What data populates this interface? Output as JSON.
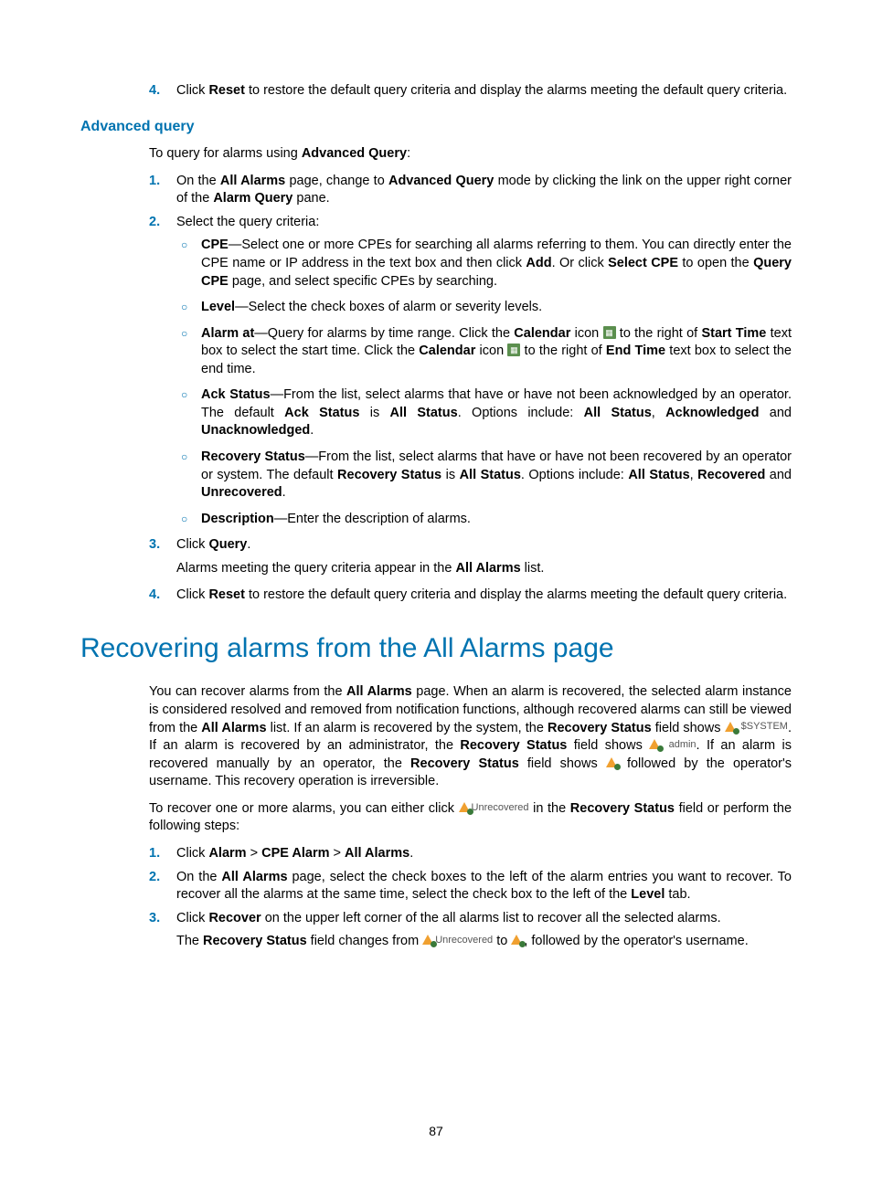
{
  "top": {
    "item4_num": "4.",
    "item4_a": "Click ",
    "item4_b": "Reset",
    "item4_c": " to restore the default query criteria and display the alarms meeting the default query criteria."
  },
  "advq": {
    "heading": "Advanced query",
    "intro_a": "To query for alarms using ",
    "intro_b": "Advanced Query",
    "intro_c": ":",
    "s1": {
      "num": "1.",
      "a": "On the ",
      "b": "All Alarms",
      "c": " page, change to ",
      "d": "Advanced Query",
      "e": " mode by clicking the link on the upper right corner of the ",
      "f": "Alarm Query",
      "g": " pane."
    },
    "s2": {
      "num": "2.",
      "a": "Select the query criteria:"
    },
    "cpe": {
      "b1": "CPE",
      "a": "—Select one or more CPEs for searching all alarms referring to them. You can directly enter the CPE name or IP address in the text box and then click ",
      "b2": "Add",
      "c": ". Or click ",
      "b3": "Select CPE",
      "d": " to open the ",
      "b4": "Query CPE",
      "e": " page, and select specific CPEs by searching."
    },
    "level": {
      "b1": "Level",
      "a": "—Select the check boxes of alarm or severity levels."
    },
    "alarmat": {
      "b1": "Alarm at",
      "a": "—Query for alarms by time range. Click the ",
      "b2": "Calendar",
      "c": " icon ",
      "d": " to the right of ",
      "b3": "Start Time",
      "e": " text box to select the start time. Click the ",
      "b4": "Calendar",
      "f": " icon ",
      "g": " to the right of ",
      "b5": "End Time",
      "h": " text box to select the end time."
    },
    "ack": {
      "b1": "Ack Status",
      "a": "—From the list, select alarms that have or have not been acknowledged by an operator. The default ",
      "b2": "Ack Status",
      "c": " is ",
      "b3": "All Status",
      "d": ". Options include: ",
      "b4": "All Status",
      "e": ", ",
      "b5": "Acknowledged",
      "f": " and ",
      "b6": "Unacknowledged",
      "g": "."
    },
    "rec": {
      "b1": "Recovery Status",
      "a": "—From the list, select alarms that have or have not been recovered by an operator or system. The default ",
      "b2": "Recovery Status",
      "c": " is ",
      "b3": "All Status",
      "d": ". Options include: ",
      "b4": "All Status",
      "e": ", ",
      "b5": "Recovered",
      "f": " and ",
      "b6": "Unrecovered",
      "g": "."
    },
    "desc": {
      "b1": "Description",
      "a": "—Enter the description of alarms."
    },
    "s3": {
      "num": "3.",
      "a": "Click ",
      "b": "Query",
      "c": ".",
      "sub_a": "Alarms meeting the query criteria appear in the ",
      "sub_b": "All Alarms",
      "sub_c": " list."
    },
    "s4": {
      "num": "4.",
      "a": "Click ",
      "b": "Reset",
      "c": " to restore the default query criteria and display the alarms meeting the default query criteria."
    }
  },
  "recov": {
    "heading": "Recovering alarms from the All Alarms page",
    "p1": {
      "a": "You can recover alarms from the ",
      "b1": "All Alarms",
      "b": " page. When an alarm is recovered, the selected alarm instance is considered resolved and removed from notification functions, although recovered alarms can still be viewed from the ",
      "b2": "All Alarms",
      "c": " list. If an alarm is recovered by the system, the ",
      "b3": "Recovery Status",
      "d": " field shows ",
      "badge1": "$SYSTEM",
      "e": ". If an alarm is recovered by an administrator, the ",
      "b4": "Recovery Status",
      "f": " field shows ",
      "badge2": "admin",
      "g": ". If an alarm is recovered manually by an operator, the ",
      "b5": "Recovery Status",
      "h": " field shows ",
      "i": " followed by the operator's username. This recovery operation is irreversible."
    },
    "p2": {
      "a": "To recover one or more alarms, you can either click ",
      "badge": "Unrecovered",
      "b": " in the ",
      "b1": "Recovery Status",
      "c": " field or perform the following steps:"
    },
    "s1": {
      "num": "1.",
      "a": "Click ",
      "b1": "Alarm",
      "gt1": " > ",
      "b2": "CPE Alarm",
      "gt2": " > ",
      "b3": "All Alarms",
      "c": "."
    },
    "s2": {
      "num": "2.",
      "a": "On the ",
      "b1": "All Alarms",
      "b": " page, select the check boxes to the left of the alarm entries you want to recover. To recover all the alarms at the same time, select the check box to the left of the ",
      "b2": "Level",
      "c": " tab."
    },
    "s3": {
      "num": "3.",
      "a": "Click ",
      "b1": "Recover",
      "b": " on the upper left corner of the all alarms list to recover all the selected alarms.",
      "sub_a": "The ",
      "sub_b1": "Recovery Status",
      "sub_b": " field changes from ",
      "sub_badge": "Unrecovered",
      "sub_c": " to ",
      "sub_d": ", followed by the operator's username."
    }
  },
  "page": "87"
}
